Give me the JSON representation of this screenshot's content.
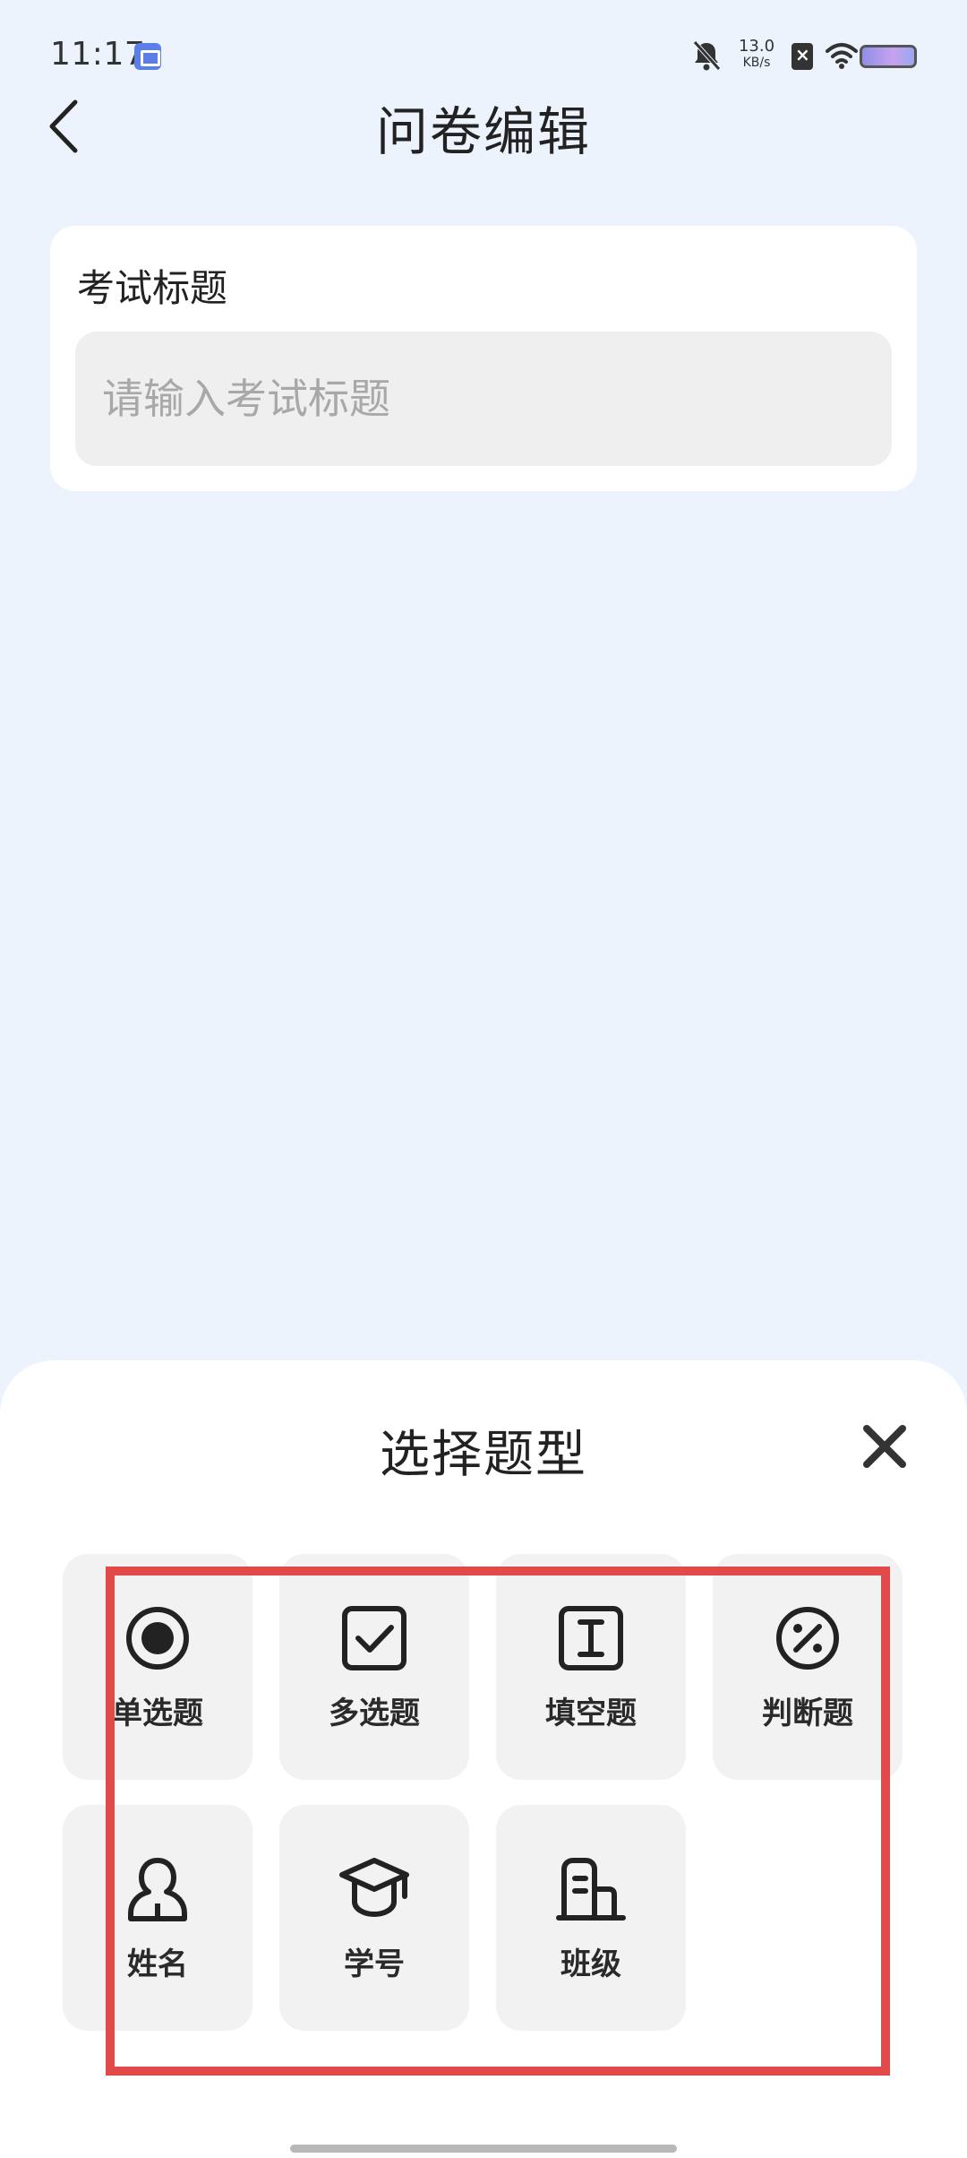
{
  "status_bar": {
    "time": "11:17",
    "net_speed_value": "13.0",
    "net_speed_unit": "KB/s"
  },
  "header": {
    "title": "问卷编辑",
    "back_icon": "chevron-left-icon"
  },
  "title_card": {
    "label": "考试标题",
    "placeholder": "请输入考试标题",
    "value": ""
  },
  "sheet": {
    "title": "选择题型",
    "close_icon": "close-icon",
    "types": [
      {
        "label": "单选题",
        "icon": "radio-icon"
      },
      {
        "label": "多选题",
        "icon": "checkbox-icon"
      },
      {
        "label": "填空题",
        "icon": "text-cursor-icon"
      },
      {
        "label": "判断题",
        "icon": "percent-circle-icon"
      },
      {
        "label": "姓名",
        "icon": "person-icon"
      },
      {
        "label": "学号",
        "icon": "graduation-cap-icon"
      },
      {
        "label": "班级",
        "icon": "building-icon"
      }
    ]
  },
  "colors": {
    "background": "#ecf3fd",
    "tile": "#f2f2f2",
    "highlight": "#e24a4a"
  }
}
